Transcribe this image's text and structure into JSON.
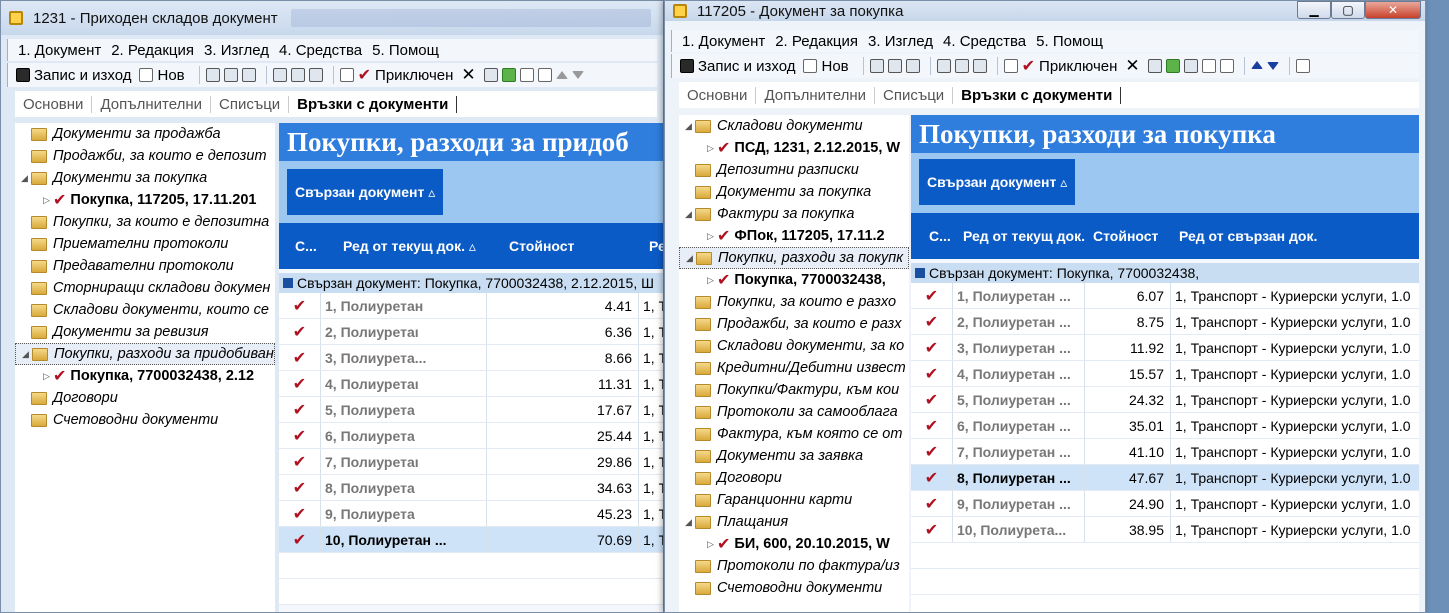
{
  "win1": {
    "title": "1231 - Приходен складов документ",
    "menu": [
      "1. Документ",
      "2. Редакция",
      "3. Изглед",
      "4. Средства",
      "5. Помощ"
    ],
    "toolbar": {
      "save": "Запис и изход",
      "new": "Нов",
      "closed": "Приключен"
    },
    "tabs": [
      "Основни",
      "Допълнителни",
      "Списъци",
      "Връзки с документи"
    ],
    "tree": [
      {
        "label": "Документи за продажба",
        "level": 0
      },
      {
        "label": "Продажби, за които е депозит",
        "level": 0
      },
      {
        "label": "Документи за покупка",
        "level": 0,
        "expanded": true
      },
      {
        "label": "Покупка, 117205, 17.11.201",
        "level": 1
      },
      {
        "label": "Покупки, за които е депозитна",
        "level": 0
      },
      {
        "label": "Приемателни протоколи",
        "level": 0
      },
      {
        "label": "Предавателни протоколи",
        "level": 0
      },
      {
        "label": "Сторниращи складови докумен",
        "level": 0
      },
      {
        "label": "Складови документи, които се",
        "level": 0
      },
      {
        "label": "Документи за ревизия",
        "level": 0
      },
      {
        "label": "Покупки, разходи за придобиван",
        "level": 0,
        "expanded": true,
        "selected": true
      },
      {
        "label": "Покупка, 7700032438, 2.12",
        "level": 1
      },
      {
        "label": "Договори",
        "level": 0
      },
      {
        "label": "Счетоводни документи",
        "level": 0
      }
    ],
    "grid": {
      "headline": "Покупки, разходи за придоб",
      "group_chip": "Свързан документ ▵",
      "columns": [
        "С...",
        "Ред от текущ док. ▵",
        "Стойност",
        "Ре"
      ],
      "group_line": "Свързан документ: Покупка, 7700032438, 2.12.2015, Ш",
      "rows": [
        {
          "check": "✔",
          "line": "1, Полиуретан",
          "value": "4.41",
          "ref": "1, Т"
        },
        {
          "check": "✔",
          "line": "2, Полиуретаı",
          "value": "6.36",
          "ref": "1, Т"
        },
        {
          "check": "✔",
          "line": "3, Полиурета...",
          "value": "8.66",
          "ref": "1, Т"
        },
        {
          "check": "✔",
          "line": "4, Полиуретаı",
          "value": "11.31",
          "ref": "1, Т"
        },
        {
          "check": "✔",
          "line": "5, Полиурета",
          "value": "17.67",
          "ref": "1, Т"
        },
        {
          "check": "✔",
          "line": "6, Полиурета",
          "value": "25.44",
          "ref": "1, Т"
        },
        {
          "check": "✔",
          "line": "7, Полиуретаı",
          "value": "29.86",
          "ref": "1, Т"
        },
        {
          "check": "✔",
          "line": "8, Полиурета",
          "value": "34.63",
          "ref": "1, Т"
        },
        {
          "check": "✔",
          "line": "9, Полиурета",
          "value": "45.23",
          "ref": "1, Т"
        },
        {
          "check": "✔",
          "line": "10, Полиуретан ...",
          "value": "70.69",
          "ref": "1, Т",
          "selected": true
        }
      ]
    }
  },
  "win2": {
    "title": "117205 - Документ за покупка",
    "menu": [
      "1. Документ",
      "2. Редакция",
      "3. Изглед",
      "4. Средства",
      "5. Помощ"
    ],
    "toolbar": {
      "save": "Запис и изход",
      "new": "Нов",
      "closed": "Приключен"
    },
    "tabs": [
      "Основни",
      "Допълнителни",
      "Списъци",
      "Връзки с документи"
    ],
    "tree": [
      {
        "label": "Складови документи",
        "level": 0,
        "expanded": true
      },
      {
        "label": "ПСД, 1231, 2.12.2015, W",
        "level": 1
      },
      {
        "label": "Депозитни разписки",
        "level": 0
      },
      {
        "label": "Документи за покупка",
        "level": 0
      },
      {
        "label": "Фактури за покупка",
        "level": 0,
        "expanded": true
      },
      {
        "label": "ФПок, 117205, 17.11.2",
        "level": 1
      },
      {
        "label": "Покупки, разходи за покупк",
        "level": 0,
        "expanded": true,
        "selected": true
      },
      {
        "label": "Покупка, 7700032438,",
        "level": 1
      },
      {
        "label": "Покупки, за които е разхо",
        "level": 0
      },
      {
        "label": "Продажби, за които е разх",
        "level": 0
      },
      {
        "label": "Складови документи, за ко",
        "level": 0
      },
      {
        "label": "Кредитни/Дебитни извест",
        "level": 0
      },
      {
        "label": "Покупки/Фактури, към кои",
        "level": 0
      },
      {
        "label": "Протоколи за самооблага",
        "level": 0
      },
      {
        "label": "Фактура, към която се от",
        "level": 0
      },
      {
        "label": "Документи за заявка",
        "level": 0
      },
      {
        "label": "Договори",
        "level": 0
      },
      {
        "label": "Гаранционни карти",
        "level": 0
      },
      {
        "label": "Плащания",
        "level": 0,
        "expanded": true
      },
      {
        "label": "БИ, 600, 20.10.2015, W",
        "level": 1
      },
      {
        "label": "Протоколи по фактура/из",
        "level": 0
      },
      {
        "label": "Счетоводни документи",
        "level": 0
      }
    ],
    "grid": {
      "headline": "Покупки, разходи за покупка",
      "group_chip": "Свързан документ ▵",
      "columns": [
        "С...",
        "Ред от текущ док.",
        "Стойност",
        "Ред от свързан док."
      ],
      "group_line": "Свързан документ: Покупка, 7700032438,",
      "rows": [
        {
          "check": "✔",
          "line": "1, Полиуретан ...",
          "value": "6.07",
          "ref": "1, Транспорт - Куриерски услуги, 1.0"
        },
        {
          "check": "✔",
          "line": "2, Полиуретан ...",
          "value": "8.75",
          "ref": "1, Транспорт - Куриерски услуги, 1.0"
        },
        {
          "check": "✔",
          "line": "3, Полиуретан ...",
          "value": "11.92",
          "ref": "1, Транспорт - Куриерски услуги, 1.0"
        },
        {
          "check": "✔",
          "line": "4, Полиуретан ...",
          "value": "15.57",
          "ref": "1, Транспорт - Куриерски услуги, 1.0"
        },
        {
          "check": "✔",
          "line": "5, Полиуретан ...",
          "value": "24.32",
          "ref": "1, Транспорт - Куриерски услуги, 1.0"
        },
        {
          "check": "✔",
          "line": "6, Полиуретан ...",
          "value": "35.01",
          "ref": "1, Транспорт - Куриерски услуги, 1.0"
        },
        {
          "check": "✔",
          "line": "7, Полиуретан ...",
          "value": "41.10",
          "ref": "1, Транспорт - Куриерски услуги, 1.0"
        },
        {
          "check": "✔",
          "line": "8, Полиуретан ...",
          "value": "47.67",
          "ref": "1, Транспорт - Куриерски услуги, 1.0",
          "selected": true
        },
        {
          "check": "✔",
          "line": "9, Полиуретан ...",
          "value": "24.90",
          "ref": "1, Транспорт - Куриерски услуги, 1.0"
        },
        {
          "check": "✔",
          "line": "10, Полиурета...",
          "value": "38.95",
          "ref": "1, Транспорт - Куриерски услуги, 1.0"
        }
      ]
    }
  }
}
